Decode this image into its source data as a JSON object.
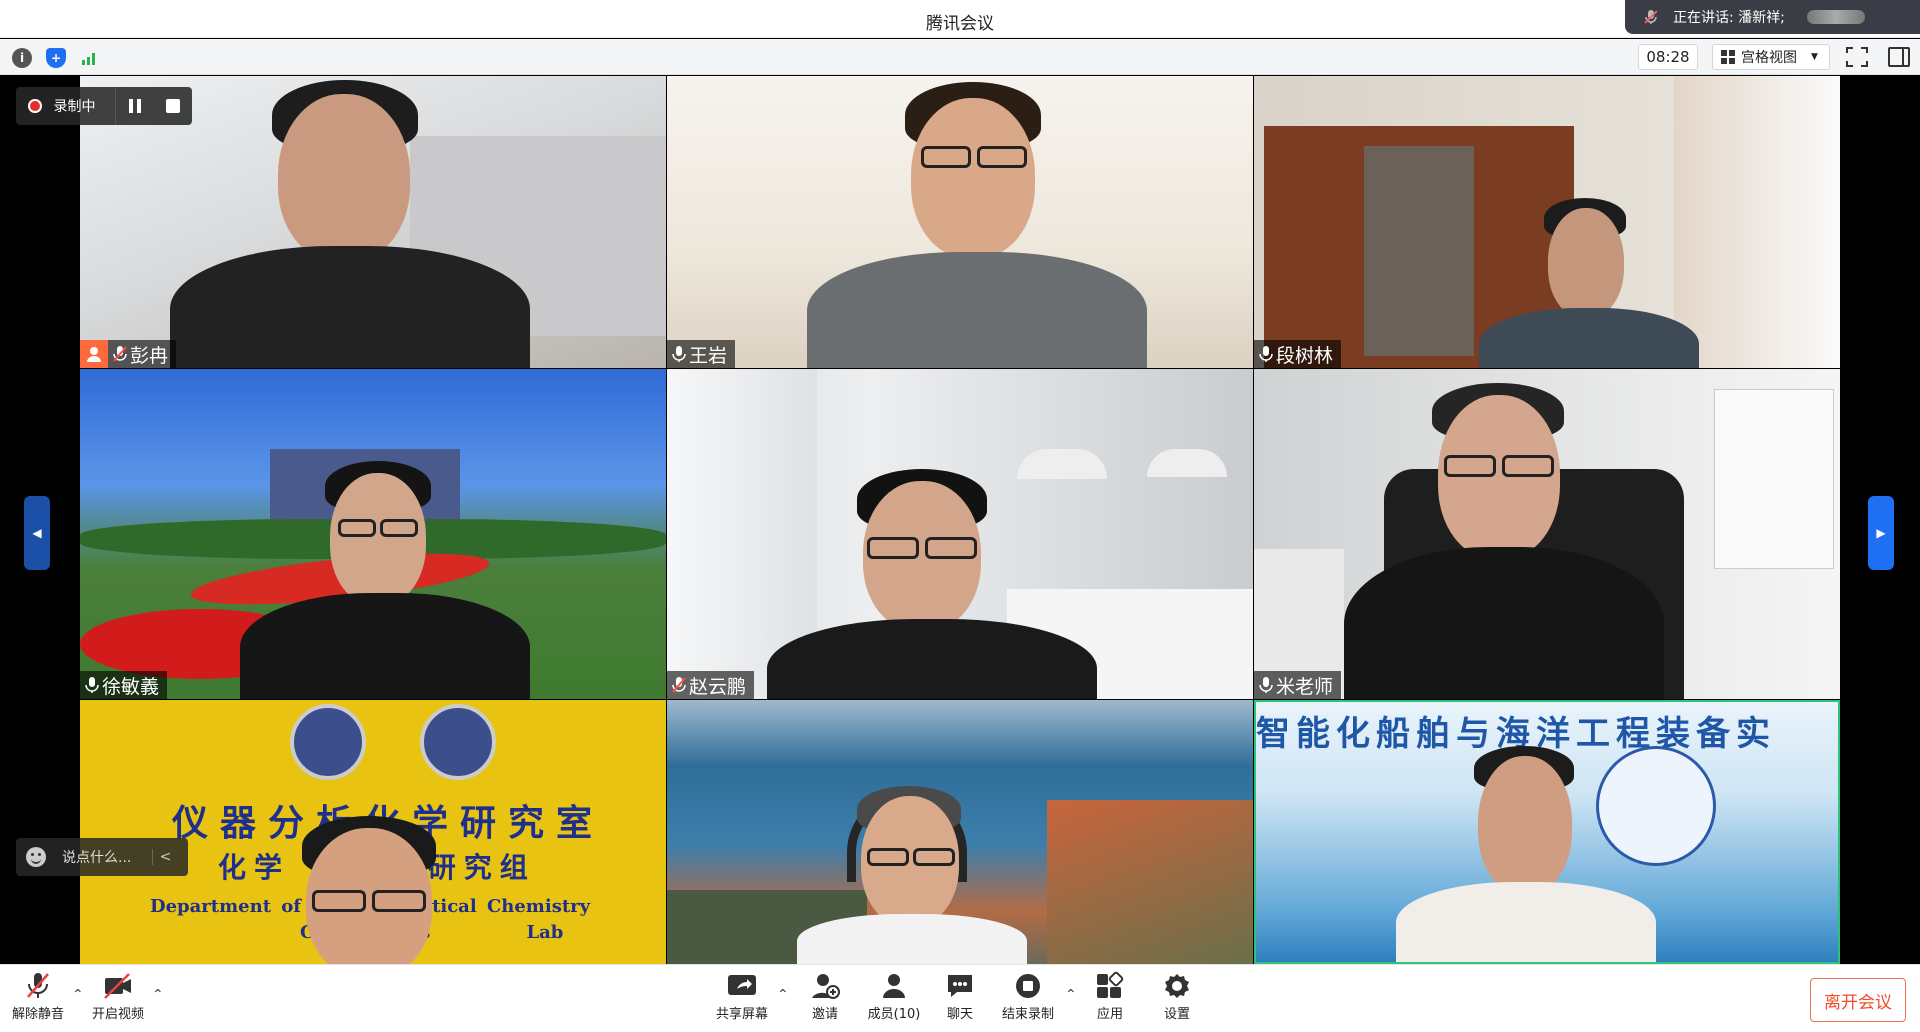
{
  "window": {
    "title": "腾讯会议"
  },
  "speaking": {
    "label": "正在讲话: 潘新祥;"
  },
  "toolbar": {
    "timer": "08:28",
    "view_mode": "宫格视图"
  },
  "recording": {
    "label": "录制中"
  },
  "participants": [
    {
      "name": "彭冉",
      "host": true,
      "muted": true
    },
    {
      "name": "王岩",
      "host": false,
      "muted": false
    },
    {
      "name": "段树林",
      "host": false,
      "muted": false
    },
    {
      "name": "徐敏義",
      "host": false,
      "muted": false
    },
    {
      "name": "赵云鹏",
      "host": false,
      "muted": true
    },
    {
      "name": "米老师",
      "host": false,
      "muted": false
    },
    {
      "name": "",
      "host": false,
      "muted": false
    },
    {
      "name": "",
      "host": false,
      "muted": false
    },
    {
      "name": "",
      "host": false,
      "muted": false
    }
  ],
  "backgrounds": {
    "lab_sign_line1": "仪器分析化学研究室",
    "lab_sign_line2": "化学 研究组",
    "lab_sign_line3": "Department of Ins d Analytical Chemistry",
    "lab_sign_line4": "C rs Lab",
    "banner": "智能化船舶与海洋工程装备实"
  },
  "chat": {
    "placeholder": "说点什么..."
  },
  "bottombar": {
    "unmute": "解除静音",
    "start_video": "开启视频",
    "share_screen": "共享屏幕",
    "invite": "邀请",
    "members": "成员(10)",
    "chat": "聊天",
    "end_recording": "结束录制",
    "apps": "应用",
    "settings": "设置",
    "leave": "离开会议"
  },
  "colors": {
    "accent": "#1f6ff2",
    "host_badge": "#ff6a3d",
    "leave": "#ef4b2e",
    "recording": "#e82b2b"
  }
}
